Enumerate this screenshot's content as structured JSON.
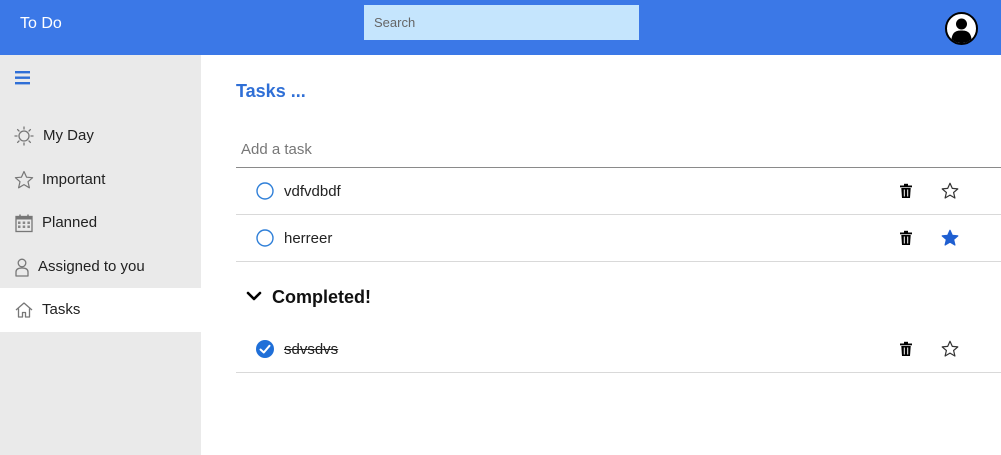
{
  "header": {
    "app_title": "To Do",
    "search_placeholder": "Search",
    "background_color": "#3b78e7",
    "search_background": "#c5e5fd"
  },
  "sidebar": {
    "background_color": "#eaeaea",
    "items": [
      {
        "label": "My Day",
        "icon": "sun-icon",
        "active": false
      },
      {
        "label": "Important",
        "icon": "star-outline-icon",
        "active": false
      },
      {
        "label": "Planned",
        "icon": "calendar-icon",
        "active": false
      },
      {
        "label": "Assigned to you",
        "icon": "person-icon",
        "active": false
      },
      {
        "label": "Tasks",
        "icon": "home-icon",
        "active": true
      }
    ]
  },
  "main": {
    "list_title": "Tasks ...",
    "add_task_placeholder": "Add a task",
    "accent_color": "#2f6fd6",
    "tasks": [
      {
        "text": "vdfvdbdf",
        "completed": false,
        "important": false
      },
      {
        "text": "herreer",
        "completed": false,
        "important": true
      }
    ],
    "completed_section_label": "Completed!",
    "completed_tasks": [
      {
        "text": "sdvsdvs",
        "completed": true,
        "important": false
      }
    ]
  }
}
